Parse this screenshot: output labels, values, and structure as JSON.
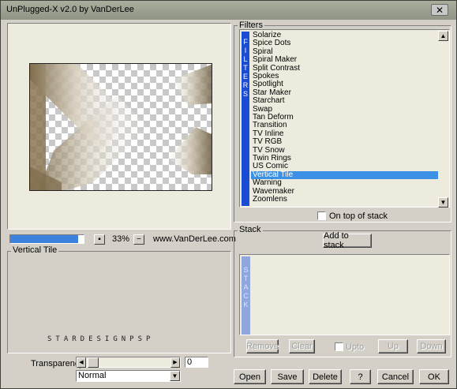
{
  "window": {
    "title": "UnPlugged-X v2.0 by VanDerLee",
    "close_glyph": "✕"
  },
  "preview": {
    "zoom_progress_fraction": 0.92,
    "zoom_out_glyph": "▪",
    "zoom_label": "33%",
    "zoom_in_glyph": "−",
    "website": "www.VanDerLee.com"
  },
  "params": {
    "group_label": "Vertical Tile",
    "watermark": "STARDESIGNPSP",
    "transparency_label": "Transparency",
    "transparency_value": "0",
    "blend_mode": "Normal",
    "left_arrow": "◀",
    "right_arrow": "▶",
    "combo_arrow": "▼"
  },
  "filters": {
    "group_label": "Filters",
    "strip_letters": [
      "F",
      "I",
      "L",
      "T",
      "E",
      "R",
      "S"
    ],
    "items": [
      "Solarize",
      "Spice Dots",
      "Spiral",
      "Spiral Maker",
      "Split Contrast",
      "Spokes",
      "Spotlight",
      "Star Maker",
      "Starchart",
      "Swap",
      "Tan Deform",
      "Transition",
      "TV Inline",
      "TV RGB",
      "TV Snow",
      "Twin Rings",
      "US Comic",
      "Vertical Tile",
      "Warning",
      "Wavemaker",
      "Zoomlens"
    ],
    "selected_index": 17,
    "on_top_label": "On top of stack",
    "scroll_up": "▲",
    "scroll_down": "▼"
  },
  "stack": {
    "group_label": "Stack",
    "add_button": "Add to stack",
    "strip_letters": [
      "S",
      "T",
      "A",
      "C",
      "K"
    ],
    "remove": "Remove",
    "clear": "Clear",
    "upto": "Upto",
    "up": "Up",
    "down": "Down"
  },
  "footer": {
    "open": "Open",
    "save": "Save",
    "delete": "Delete",
    "help": "?",
    "cancel": "Cancel",
    "ok": "OK"
  }
}
